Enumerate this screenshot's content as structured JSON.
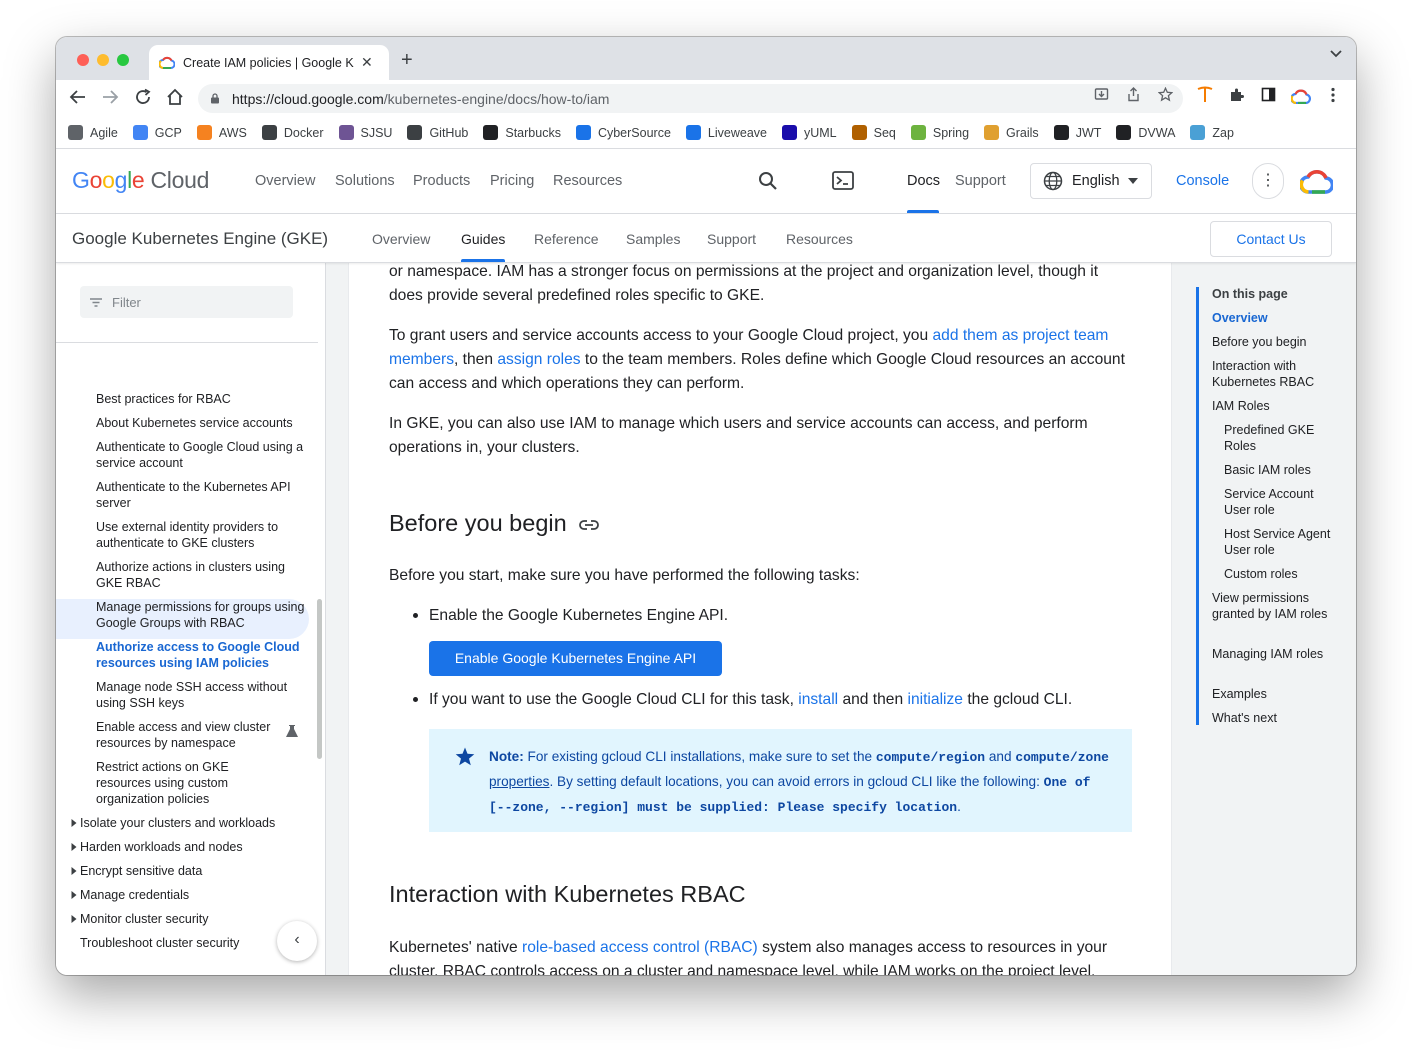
{
  "browser": {
    "tab_title": "Create IAM policies  |  Google K",
    "close_glyph": "✕",
    "new_tab_glyph": "+",
    "url_host": "https://cloud.google.com",
    "url_path": "/kubernetes-engine/docs/how-to/iam",
    "bookmarks": [
      "Agile",
      "GCP",
      "AWS",
      "Docker",
      "SJSU",
      "GitHub",
      "Starbucks",
      "CyberSource",
      "Liveweave",
      "yUML",
      "Seq",
      "Spring",
      "Grails",
      "JWT",
      "DVWA",
      "Zap"
    ],
    "bookmark_icons": [
      "agile-icon",
      "gcp-api-icon",
      "aws-cube-icon",
      "docker-icon",
      "github-icon",
      "github-icon",
      "starbucks-icon",
      "cybersource-icon",
      "liveweave-icon",
      "yuml-icon",
      "seq-icon",
      "spring-icon",
      "grails-icon",
      "jwt-icon",
      "dvwa-icon",
      "zap-icon"
    ],
    "bookmark_colors": [
      "#5f6368",
      "#4285f4",
      "#f58220",
      "#3c4043",
      "#6e5494",
      "#3c4043",
      "#202124",
      "#1a73e8",
      "#1a73e8",
      "#1a0dab",
      "#b06000",
      "#6db33f",
      "#e0a030",
      "#202124",
      "#202124",
      "#4aa0d5"
    ]
  },
  "header": {
    "logo_google": [
      "G",
      "o",
      "o",
      "g",
      "l",
      "e"
    ],
    "logo_colors": [
      "#4285f4",
      "#ea4335",
      "#fbbc05",
      "#4285f4",
      "#34a853",
      "#ea4335"
    ],
    "logo_cloud": "Cloud",
    "nav": [
      "Overview",
      "Solutions",
      "Products",
      "Pricing",
      "Resources"
    ],
    "docs": "Docs",
    "support": "Support",
    "language": "English",
    "console": "Console",
    "kebab_glyph": "⋮"
  },
  "subheader": {
    "product": "Google Kubernetes Engine (GKE)",
    "tabs": [
      "Overview",
      "Guides",
      "Reference",
      "Samples",
      "Support",
      "Resources"
    ],
    "active_tab": "Guides",
    "contact": "Contact Us"
  },
  "sidebar": {
    "filter_placeholder": "Filter",
    "items": [
      "Best practices for RBAC",
      "About Kubernetes service accounts",
      "Authenticate to Google Cloud using a service account",
      "Authenticate to the Kubernetes API server",
      "Use external identity providers to authenticate to GKE clusters",
      "Authorize actions in clusters using GKE RBAC",
      "Manage permissions for groups using Google Groups with RBAC",
      "Authorize access to Google Cloud resources using IAM policies",
      "Manage node SSH access without using SSH keys",
      "Enable access and view cluster resources by namespace",
      "Restrict actions on GKE resources using custom organization policies"
    ],
    "sections": [
      "Isolate your clusters and workloads",
      "Harden workloads and nodes",
      "Encrypt sensitive data",
      "Manage credentials",
      "Monitor cluster security"
    ],
    "last": "Troubleshoot cluster security",
    "collapse_glyph": "‹"
  },
  "article": {
    "p1": "or namespace. IAM has a stronger focus on permissions at the project and organization level, though it does provide several predefined roles specific to GKE.",
    "p2_a": "To grant users and service accounts access to your Google Cloud project, you ",
    "p2_link1": "add them as project team members",
    "p2_b": ", then ",
    "p2_link2": "assign roles",
    "p2_c": " to the team members. Roles define which Google Cloud resources an account can access and which operations they can perform.",
    "p3": "In GKE, you can also use IAM to manage which users and service accounts can access, and perform operations in, your clusters.",
    "h_before": "Before you begin",
    "p4": "Before you start, make sure you have performed the following tasks:",
    "li1": "Enable the Google Kubernetes Engine API.",
    "button": "Enable Google Kubernetes Engine API",
    "li2_a": "If you want to use the Google Cloud CLI for this task, ",
    "li2_link1": "install",
    "li2_b": " and then ",
    "li2_link2": "initialize",
    "li2_c": " the gcloud CLI.",
    "note_label": "Note:",
    "note_a": " For existing gcloud CLI installations, make sure to set the ",
    "note_code1": "compute/region",
    "note_b": " and ",
    "note_code2": "compute/zone",
    "note_c": " ",
    "note_link": "properties",
    "note_d": ". By setting default locations, you can avoid errors in gcloud CLI like the following: ",
    "note_code3": "One of [--zone, --region] must be supplied: Please specify location",
    "note_e": ".",
    "h_rbac": "Interaction with Kubernetes RBAC",
    "p5_a": "Kubernetes' native ",
    "p5_link": "role-based access control (RBAC)",
    "p5_b": " system also manages access to resources in your cluster. RBAC controls access on a cluster and namespace level, while IAM works on the project level."
  },
  "toc": {
    "heading": "On this page",
    "items": [
      {
        "label": "Overview",
        "level": 1
      },
      {
        "label": "Before you begin",
        "level": 1
      },
      {
        "label": "Interaction with Kubernetes RBAC",
        "level": 1
      },
      {
        "label": "IAM Roles",
        "level": 1
      },
      {
        "label": "Predefined GKE Roles",
        "level": 2
      },
      {
        "label": "Basic IAM roles",
        "level": 2
      },
      {
        "label": "Service Account User role",
        "level": 2
      },
      {
        "label": "Host Service Agent User role",
        "level": 2
      },
      {
        "label": "Custom roles",
        "level": 2
      },
      {
        "label": "View permissions granted by IAM roles",
        "level": 1
      },
      {
        "label": "Managing IAM roles",
        "level": 1
      },
      {
        "label": "Examples",
        "level": 1
      },
      {
        "label": "What's next",
        "level": 1
      }
    ],
    "current": "Overview"
  },
  "colors": {
    "link": "#1a73e8",
    "primary_button": "#1a73e8",
    "selected_nav_bg": "#e8f0fe",
    "note_bg": "#e1f5fe"
  }
}
